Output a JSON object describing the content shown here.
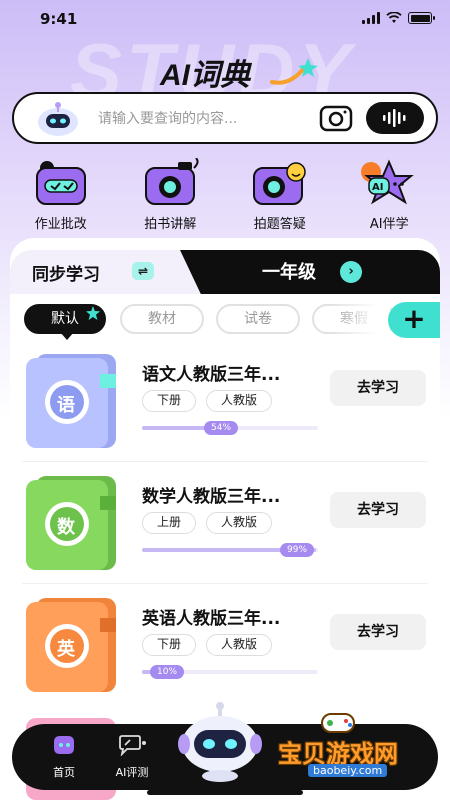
{
  "status_bar": {
    "time": "9:41"
  },
  "header": {
    "bg_word": "STUDY",
    "title": "AI词典"
  },
  "search": {
    "placeholder": "请输入要查询的内容..."
  },
  "features": [
    {
      "label": "作业批改",
      "icon": "homework-check-icon"
    },
    {
      "label": "拍书讲解",
      "icon": "book-camera-icon"
    },
    {
      "label": "拍题答疑",
      "icon": "question-camera-icon"
    },
    {
      "label": "AI伴学",
      "icon": "ai-companion-icon"
    }
  ],
  "tabs": {
    "sync_label": "同步学习",
    "sync_switch": "⇌",
    "grade_label": "一年级",
    "grade_arrow": "›"
  },
  "filters": [
    "默认",
    "教材",
    "试卷",
    "寒假"
  ],
  "add_button": "+",
  "books": [
    {
      "cover_char": "语",
      "title": "语文人教版三年...",
      "tags": [
        "下册",
        "人教版"
      ],
      "progress": 54,
      "progress_label": "54%",
      "action": "去学习",
      "color": "purple"
    },
    {
      "cover_char": "数",
      "title": "数学人教版三年...",
      "tags": [
        "上册",
        "人教版"
      ],
      "progress": 99,
      "progress_label": "99%",
      "action": "去学习",
      "color": "green"
    },
    {
      "cover_char": "英",
      "title": "英语人教版三年...",
      "tags": [
        "下册",
        "人教版"
      ],
      "progress": 10,
      "progress_label": "10%",
      "action": "去学习",
      "color": "orange"
    }
  ],
  "bottom_nav": [
    {
      "label": "首页",
      "icon": "home-icon"
    },
    {
      "label": "AI评测",
      "icon": "ai-review-icon"
    }
  ],
  "watermark": {
    "text": "宝贝游戏网",
    "url": "baobeiy.com"
  },
  "colors": {
    "accent": "#3fe0cf",
    "dark": "#111111",
    "progress": "#a58af0",
    "brand_purple": "#cdbdf7"
  }
}
